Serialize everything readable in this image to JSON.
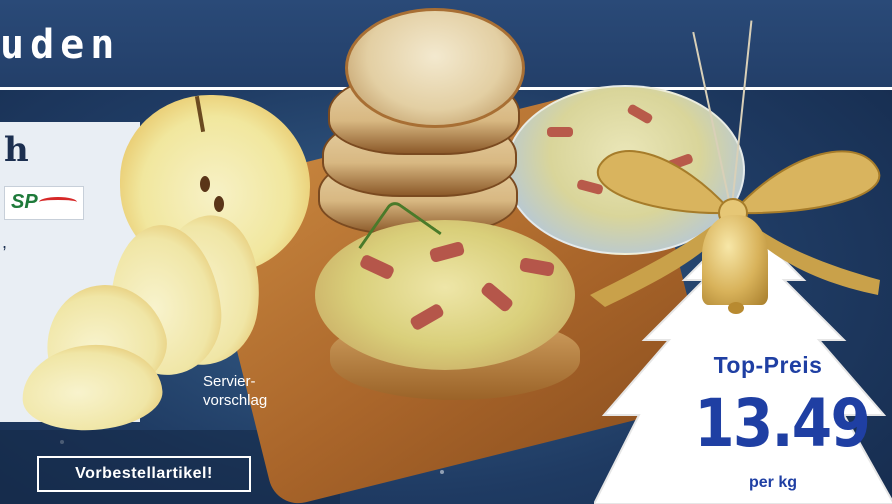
{
  "banner": {
    "title": "uden"
  },
  "panel": {
    "letter": "h",
    "comma": ",",
    "logo_text": "SP"
  },
  "preorder_label": "Vorbestellartikel!",
  "serving": {
    "line1": "Servier-",
    "line2": "vorschlag"
  },
  "price_tag": {
    "headline": "Top-Preis",
    "price": "13.49",
    "unit": "per kg"
  },
  "colors": {
    "banner": "#233f69",
    "price_blue": "#1f3fa3",
    "gold": "#d8b25a",
    "apple_red": "#d23b2a"
  },
  "icons": [
    "bell-icon",
    "ribbon-bow-icon",
    "sp-logo-icon"
  ]
}
